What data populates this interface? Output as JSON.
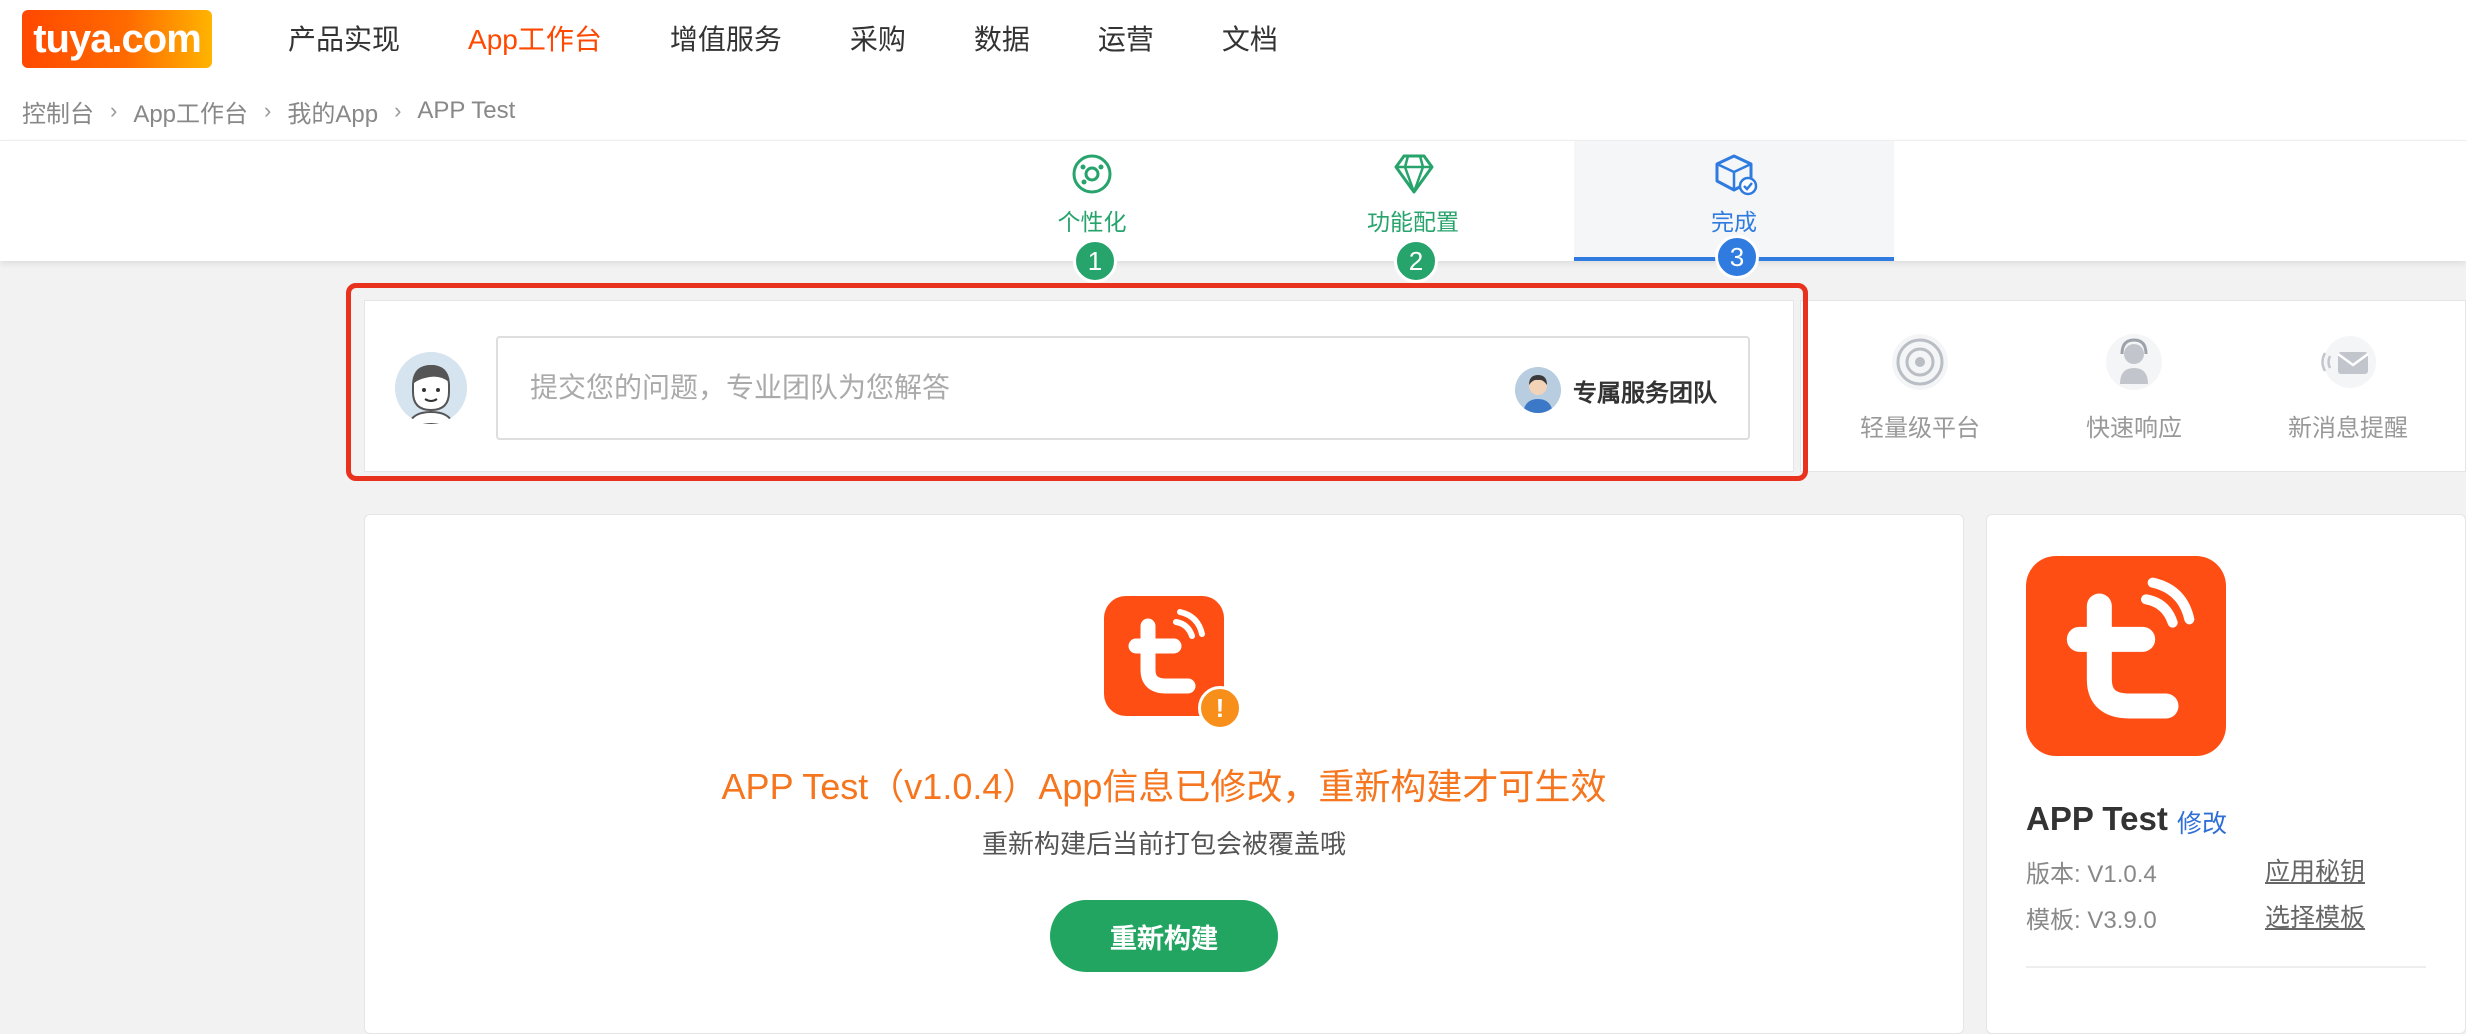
{
  "brand": {
    "logo_text": "tuya.com",
    "accent": "#ff4800"
  },
  "nav": {
    "items": [
      {
        "label": "产品实现"
      },
      {
        "label": "App工作台",
        "active": true
      },
      {
        "label": "增值服务"
      },
      {
        "label": "采购"
      },
      {
        "label": "数据"
      },
      {
        "label": "运营"
      },
      {
        "label": "文档"
      }
    ]
  },
  "breadcrumb": {
    "items": [
      {
        "label": "控制台"
      },
      {
        "label": "App工作台"
      },
      {
        "label": "我的App"
      },
      {
        "label": "APP Test"
      }
    ],
    "separator": "›"
  },
  "steps": [
    {
      "label": "个性化",
      "number": "1",
      "icon": "palette-gear-icon",
      "state": "done"
    },
    {
      "label": "功能配置",
      "number": "2",
      "icon": "diamond-icon",
      "state": "done"
    },
    {
      "label": "完成",
      "number": "3",
      "icon": "box-check-icon",
      "state": "active"
    }
  ],
  "question": {
    "placeholder": "提交您的问题，专业团队为您解答",
    "value": "",
    "team_label": "专属服务团队"
  },
  "features": [
    {
      "label": "轻量级平台",
      "icon": "target-icon"
    },
    {
      "label": "快速响应",
      "icon": "support-agent-icon"
    },
    {
      "label": "新消息提醒",
      "icon": "message-bell-icon"
    }
  ],
  "main": {
    "warning_badge": "!",
    "warning_title": "APP Test（v1.0.4）App信息已修改，重新构建才可生效",
    "warning_subtitle": "重新构建后当前打包会被覆盖哦",
    "rebuild_label": "重新构建",
    "warning_color": "#f5761e",
    "button_color": "#21a561"
  },
  "side": {
    "app_name": "APP Test",
    "edit_label": "修改",
    "version_text": "版本: V1.0.4",
    "template_text": "模板: V3.9.0",
    "secret_link": "应用秘钥",
    "template_link": "选择模板"
  },
  "colors": {
    "step_done": "#27a36c",
    "step_active": "#2f7be0",
    "highlight": "#e8321e"
  }
}
